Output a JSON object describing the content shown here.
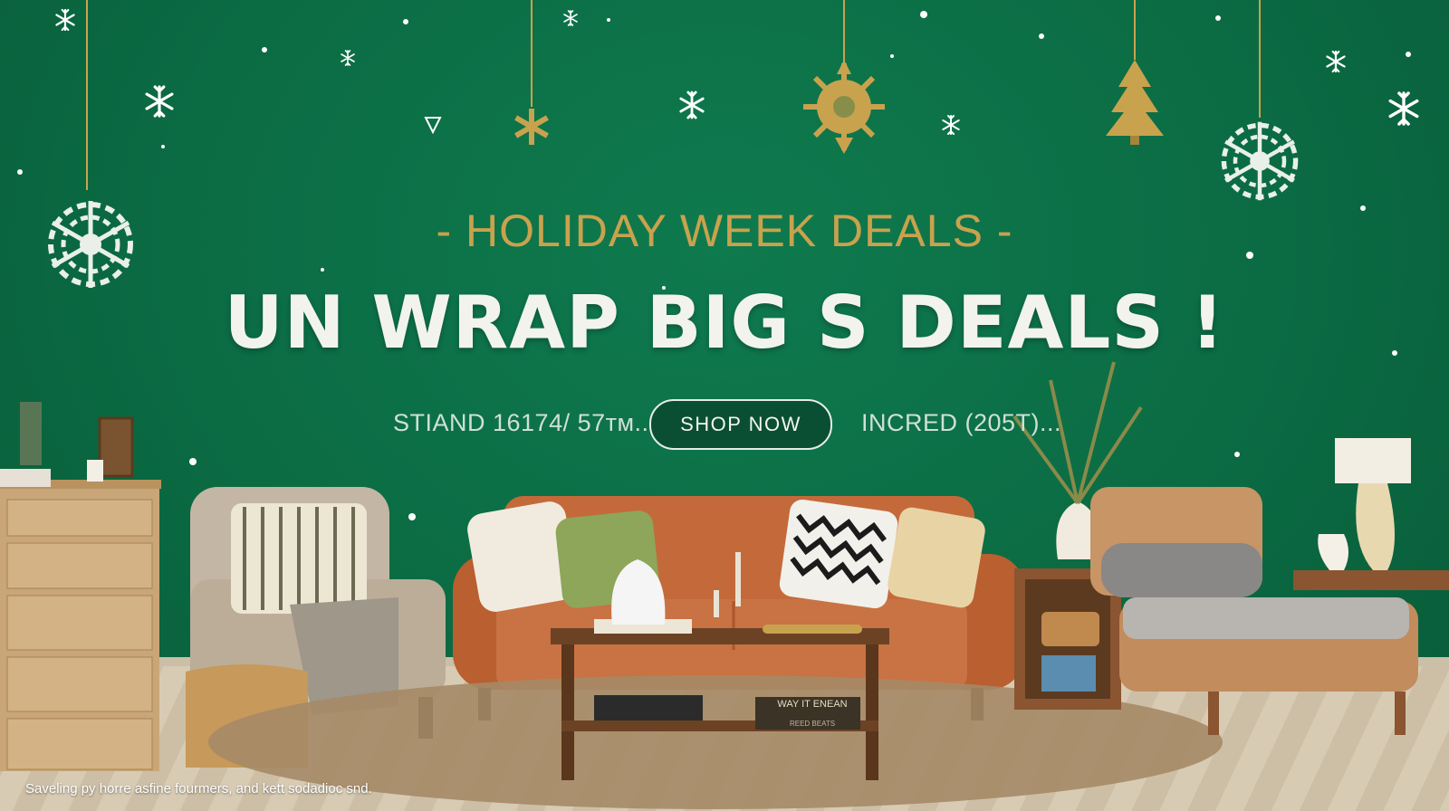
{
  "banner": {
    "eyebrow": "- HOLIDAY WEEK DEALS -",
    "headline": "UN WRAP BIG S DEALS !",
    "promo_left": "STIAND 16174/ 57ᴛᴍ..",
    "shop_button_label": "SHOP NOW",
    "promo_right": "INCRED (205T)...",
    "caption": "Saveling py horre asfine fourmers, and kett sodadioc snd.",
    "coffee_book_title": "WAY IT ENEAN",
    "coffee_book_subtitle": "REED BEATS"
  },
  "colors": {
    "background": "#0b6b43",
    "gold": "#c9a24e",
    "headline": "#f3f3ee",
    "button_fill": "#0a4f33",
    "sofa": "#c46a3a"
  },
  "icons": [
    "snowflake-icon",
    "sun-ornament-icon",
    "tree-ornament-icon",
    "star-icon",
    "triangle-icon"
  ]
}
